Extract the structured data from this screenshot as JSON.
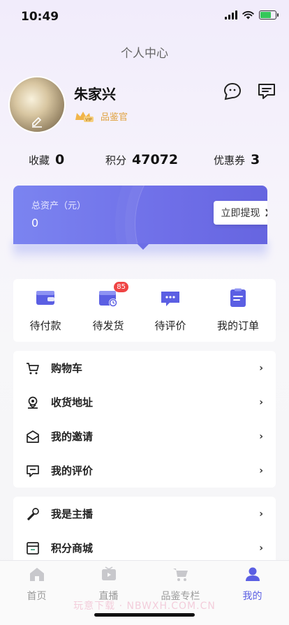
{
  "status_bar": {
    "time": "10:49"
  },
  "page": {
    "title": "个人中心"
  },
  "profile": {
    "name": "朱家兴",
    "badge": "品鉴官"
  },
  "stats": [
    {
      "label": "收藏",
      "value": "0"
    },
    {
      "label": "积分",
      "value": "47072"
    },
    {
      "label": "优惠券",
      "value": "3"
    }
  ],
  "assets": {
    "label": "总资产（元）",
    "value": "0",
    "withdraw_label": "立即提现"
  },
  "orders": [
    {
      "label": "待付款",
      "icon": "wallet-icon"
    },
    {
      "label": "待发货",
      "icon": "calendar-clock-icon",
      "badge": "85"
    },
    {
      "label": "待评价",
      "icon": "chat-bubble-icon"
    },
    {
      "label": "我的订单",
      "icon": "clipboard-icon"
    }
  ],
  "menu_group_1": [
    {
      "label": "购物车",
      "icon": "cart-icon"
    },
    {
      "label": "收货地址",
      "icon": "location-icon"
    },
    {
      "label": "我的邀请",
      "icon": "mail-icon"
    },
    {
      "label": "我的评价",
      "icon": "comment-icon"
    }
  ],
  "menu_group_2": [
    {
      "label": "我是主播",
      "icon": "microphone-icon"
    },
    {
      "label": "积分商城",
      "icon": "store-icon"
    }
  ],
  "tabs": [
    {
      "label": "首页",
      "icon": "home-icon"
    },
    {
      "label": "直播",
      "icon": "tv-icon"
    },
    {
      "label": "品鉴专栏",
      "icon": "cart-icon"
    },
    {
      "label": "我的",
      "icon": "person-icon",
      "active": true
    }
  ],
  "watermark": "玩意下载 · NBWXH.COM.CN",
  "colors": {
    "accent": "#5b5fe3",
    "badge_gold": "#e0a23f",
    "notification": "#ef4444"
  }
}
